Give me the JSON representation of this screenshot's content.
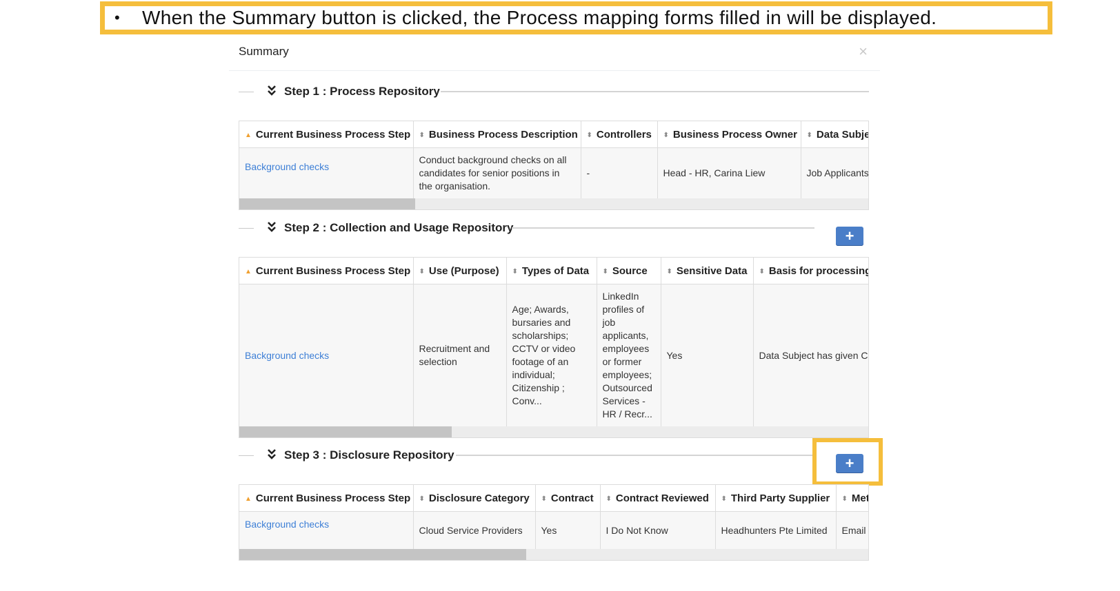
{
  "callout": {
    "bullet": "•",
    "text": "When the Summary button is clicked, the Process mapping forms filled in will be displayed."
  },
  "modal": {
    "title": "Summary",
    "close_icon": "×"
  },
  "icons": {
    "step_toggle": "double-chevron-down-icon",
    "sort_both": "sort-icon",
    "sort_asc": "sort-asc-icon",
    "add": "plus-icon"
  },
  "glyphs": {
    "chevron": "»",
    "sort_both": "⬍",
    "sort_asc": "▲",
    "plus": "+"
  },
  "colors": {
    "accent_highlight": "#f5be3c",
    "button_blue": "#4a7ec8",
    "link": "#3d7fd6",
    "sort_asc": "#f0a030"
  },
  "step1": {
    "title": "Step 1 : Process Repository",
    "columns": [
      "Current Business Process Step",
      "Business Process Description",
      "Controllers",
      "Business Process Owner",
      "Data Subje"
    ],
    "rows": [
      [
        "Background checks",
        "Conduct background checks on all candidates for senior positions in the organisation.",
        "-",
        "Head - HR, Carina Liew",
        "Job Applicants"
      ]
    ]
  },
  "step2": {
    "title": "Step 2 : Collection and Usage Repository",
    "add_label": "+",
    "columns": [
      "Current Business Process Step",
      "Use (Purpose)",
      "Types of Data",
      "Source",
      "Sensitive Data",
      "Basis for processing"
    ],
    "rows": [
      [
        "Background checks",
        "Recruitment and selection",
        "Age; Awards, bursaries and scholarships; CCTV or video footage of an individual; Citizenship ; Conv...",
        "LinkedIn profiles of job applicants, employees or former employees; Outsourced Services - HR / Recr...",
        "Yes",
        "Data Subject has given C Information"
      ]
    ]
  },
  "step3": {
    "title": "Step 3 : Disclosure Repository",
    "add_label": "+",
    "columns": [
      "Current Business Process Step",
      "Disclosure Category",
      "Contract",
      "Contract Reviewed",
      "Third Party Supplier",
      "Met"
    ],
    "rows": [
      [
        "Background checks",
        "Cloud Service Providers",
        "Yes",
        "I Do Not Know",
        "Headhunters Pte Limited",
        "Email"
      ]
    ]
  }
}
